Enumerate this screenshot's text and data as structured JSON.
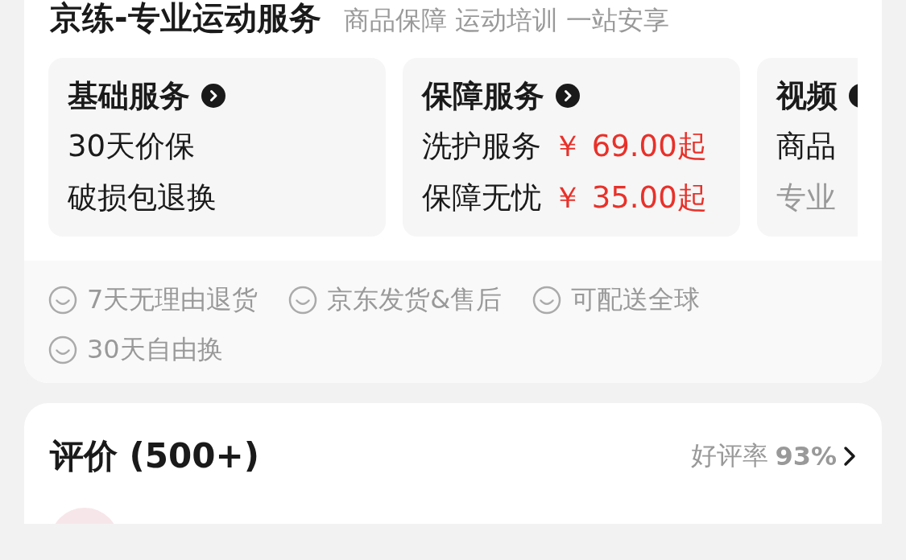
{
  "service_section": {
    "title": "京练-专业运动服务",
    "subtitle": "商品保障 运动培训 一站安享",
    "cards": [
      {
        "title": "基础服务",
        "lines": [
          {
            "label": "30天价保",
            "muted": false
          },
          {
            "label": "破损包退换",
            "muted": false
          }
        ]
      },
      {
        "title": "保障服务",
        "lines": [
          {
            "label": "洗护服务",
            "price": "￥ 69.00起",
            "muted": false
          },
          {
            "label": "保障无忧",
            "price": "￥ 35.00起",
            "muted": false
          }
        ]
      },
      {
        "title": "视频",
        "lines": [
          {
            "label": "商品",
            "muted": false
          },
          {
            "label": "专业",
            "muted": true
          }
        ]
      }
    ],
    "guarantees": [
      "7天无理由退货",
      "京东发货&售后",
      "可配送全球",
      "30天自由换"
    ]
  },
  "reviews": {
    "title": "评价 (500+)",
    "rating_label": "好评率",
    "rating_value": "93%"
  }
}
